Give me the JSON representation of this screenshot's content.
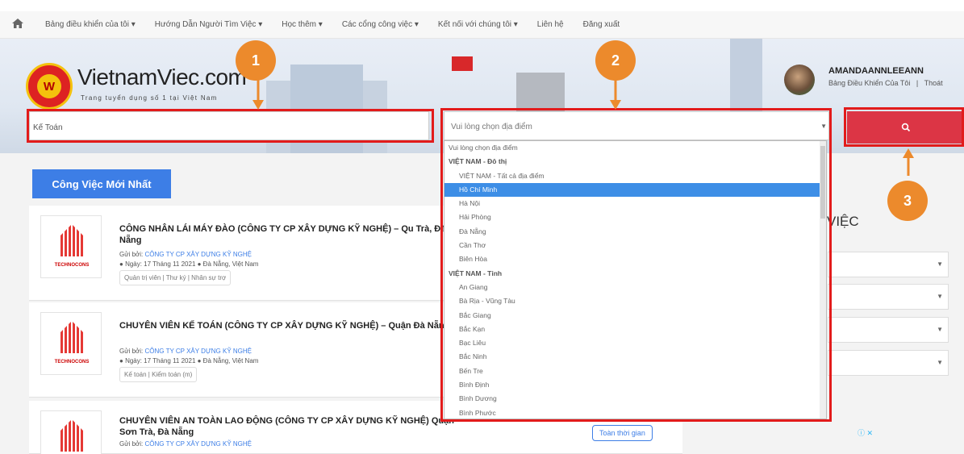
{
  "nav": {
    "home_icon": "home-icon",
    "items": [
      {
        "label": "Bảng điều khiển của tôi",
        "dropdown": true
      },
      {
        "label": "Hướng Dẫn Người Tìm Việc",
        "dropdown": true
      },
      {
        "label": "Học thêm",
        "dropdown": true
      },
      {
        "label": "Các cổng công việc",
        "dropdown": true
      },
      {
        "label": "Kết nối với chúng tôi",
        "dropdown": true
      },
      {
        "label": "Liên hệ",
        "dropdown": false
      },
      {
        "label": "Đăng xuất",
        "dropdown": false
      }
    ]
  },
  "header": {
    "logo_mark": "W",
    "logo_name": "VietnamViec.com",
    "tagline": "Trang tuyển dụng số 1 tại Việt Nam",
    "username": "AMANDAANNLEEANN",
    "dashboard_link": "Bảng Điều Khiển Của Tôi",
    "logout_link": "Thoát",
    "link_separator": "|"
  },
  "search": {
    "keyword_value": "Kế Toán",
    "location_placeholder": "Vui lòng chọn địa điểm",
    "button_icon": "search-icon"
  },
  "dropdown": {
    "items": [
      {
        "label": "Vui lòng chọn địa điểm",
        "kind": "option"
      },
      {
        "label": "VIỆT NAM - Đô thị",
        "kind": "group"
      },
      {
        "label": "VIỆT NAM - Tất cả địa điểm",
        "kind": "sub"
      },
      {
        "label": "Hồ Chí Minh",
        "kind": "selected"
      },
      {
        "label": "Hà Nội",
        "kind": "sub"
      },
      {
        "label": "Hải Phòng",
        "kind": "sub"
      },
      {
        "label": "Đà Nẵng",
        "kind": "sub"
      },
      {
        "label": "Cần Thơ",
        "kind": "sub"
      },
      {
        "label": "Biên Hòa",
        "kind": "sub"
      },
      {
        "label": "VIỆT NAM - Tỉnh",
        "kind": "group"
      },
      {
        "label": "An Giang",
        "kind": "sub"
      },
      {
        "label": "Bà Rịa - Vũng Tàu",
        "kind": "sub"
      },
      {
        "label": "Bắc Giang",
        "kind": "sub"
      },
      {
        "label": "Bắc Kạn",
        "kind": "sub"
      },
      {
        "label": "Bạc Liêu",
        "kind": "sub"
      },
      {
        "label": "Bắc Ninh",
        "kind": "sub"
      },
      {
        "label": "Bến Tre",
        "kind": "sub"
      },
      {
        "label": "Bình Định",
        "kind": "sub"
      },
      {
        "label": "Bình Dương",
        "kind": "sub"
      },
      {
        "label": "Bình Phước",
        "kind": "sub"
      }
    ]
  },
  "main": {
    "tab_label": "Công Việc Mới Nhất",
    "jobs": [
      {
        "title": "CÔNG NHÂN LÁI MÁY ĐÀO (CÔNG TY CP XÂY DỰNG KỸ NGHỆ) – Qu Trà, Đà Nẵng",
        "posted_by_label": "Gửi bởi:",
        "company": "CÔNG TY CP XÂY DỰNG KỸ NGHỆ",
        "date": "Ngày: 17 Tháng 11 2021",
        "location": "Đà Nẵng, Việt Nam",
        "tag": "Quản trị viên | Thư ký | Nhân sự trợ",
        "logo_text": "TECHNOCONS"
      },
      {
        "title": "CHUYÊN VIÊN KẾ TOÁN (CÔNG TY CP XÂY DỰNG KỸ NGHỆ) – Quận Đà Nẵng",
        "posted_by_label": "Gửi bởi:",
        "company": "CÔNG TY CP XÂY DỰNG KỸ NGHỆ",
        "date": "Ngày: 17 Tháng 11 2021",
        "location": "Đà Nẵng, Việt Nam",
        "tag": "Kế toán | Kiểm toán (m)",
        "logo_text": "TECHNOCONS"
      },
      {
        "title": "CHUYÊN VIÊN AN TOÀN LAO ĐỘNG (CÔNG TY CP XÂY DỰNG KỸ NGHỆ) Quận Sơn Trà, Đà Nẵng",
        "posted_by_label": "Gửi bởi:",
        "company": "CÔNG TY CP XÂY DỰNG KỸ NGHỆ",
        "badge": "Toàn thời gian"
      }
    ]
  },
  "sidebar": {
    "heading_partial": "VIỆC",
    "filter_count": 4,
    "ad_icons": "ⓘ ✕"
  },
  "annotations": {
    "callouts": [
      "1",
      "2",
      "3"
    ],
    "highlight_color": "#e21b1b",
    "callout_color": "#ec8a2c"
  },
  "colors": {
    "accent_blue": "#3d7ee6",
    "search_red": "#dc3545"
  }
}
